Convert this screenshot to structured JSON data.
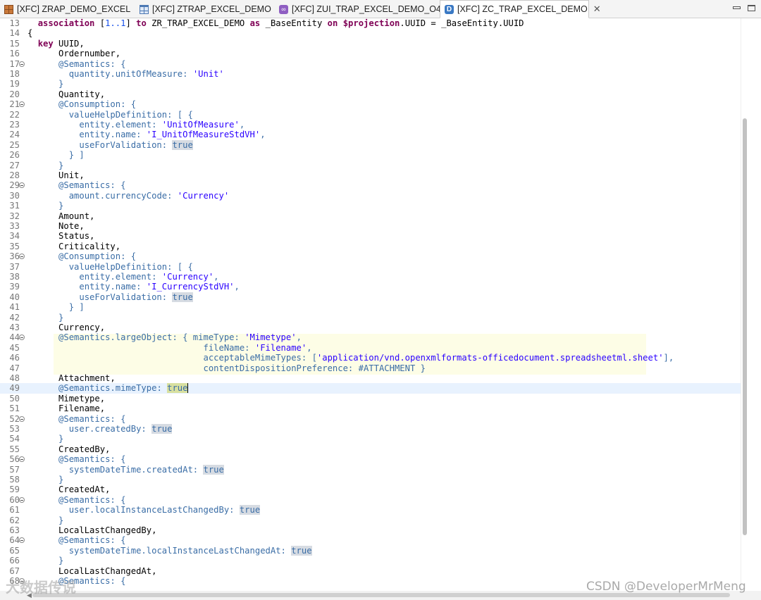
{
  "tabs": [
    {
      "label": "[XFC] ZRAP_DEMO_EXCEL",
      "icon": "database-table-icon",
      "active": false
    },
    {
      "label": "[XFC] ZTRAP_EXCEL_DEMO",
      "icon": "table-icon",
      "active": false
    },
    {
      "label": "[XFC] ZUI_TRAP_EXCEL_DEMO_O4",
      "icon": "service-binding-icon",
      "active": false
    },
    {
      "label": "[XFC] ZC_TRAP_EXCEL_DEMO",
      "icon": "data-definition-icon",
      "active": true,
      "icon_letter": "D"
    }
  ],
  "code_lines": [
    {
      "n": "13",
      "s": [
        [
          "  ",
          ""
        ],
        [
          "association",
          "kw"
        ],
        [
          " [",
          ""
        ],
        [
          "1..1",
          "num"
        ],
        [
          "] ",
          ""
        ],
        [
          "to",
          "kw"
        ],
        [
          " ZR_TRAP_EXCEL_DEMO ",
          ""
        ],
        [
          "as",
          "kw"
        ],
        [
          " _BaseEntity ",
          ""
        ],
        [
          "on",
          "kw"
        ],
        [
          " ",
          ""
        ],
        [
          "$projection",
          "kw"
        ],
        [
          ".UUID = _BaseEntity.UUID",
          ""
        ]
      ]
    },
    {
      "n": "14",
      "s": [
        [
          "{",
          ""
        ]
      ]
    },
    {
      "n": "15",
      "s": [
        [
          "  ",
          ""
        ],
        [
          "key",
          "kw"
        ],
        [
          " UUID,",
          ""
        ]
      ]
    },
    {
      "n": "16",
      "s": [
        [
          "      Ordernumber,",
          ""
        ]
      ]
    },
    {
      "n": "17",
      "fold": true,
      "s": [
        [
          "      ",
          ""
        ],
        [
          "@Semantics: {",
          "ann"
        ]
      ]
    },
    {
      "n": "18",
      "s": [
        [
          "        ",
          ""
        ],
        [
          "quantity.unitOfMeasure: ",
          "ann"
        ],
        [
          "'Unit'",
          "str"
        ]
      ]
    },
    {
      "n": "19",
      "s": [
        [
          "      ",
          ""
        ],
        [
          "}",
          "ann"
        ]
      ]
    },
    {
      "n": "20",
      "s": [
        [
          "      Quantity,",
          ""
        ]
      ]
    },
    {
      "n": "21",
      "fold": true,
      "s": [
        [
          "      ",
          ""
        ],
        [
          "@Consumption: {",
          "ann"
        ]
      ]
    },
    {
      "n": "22",
      "s": [
        [
          "        ",
          ""
        ],
        [
          "valueHelpDefinition: [ {",
          "ann"
        ]
      ]
    },
    {
      "n": "23",
      "s": [
        [
          "          ",
          ""
        ],
        [
          "entity.element: ",
          "ann"
        ],
        [
          "'UnitOfMeasure'",
          "str"
        ],
        [
          ",",
          "ann"
        ]
      ]
    },
    {
      "n": "24",
      "s": [
        [
          "          ",
          ""
        ],
        [
          "entity.name: ",
          "ann"
        ],
        [
          "'I_UnitOfMeasureStdVH'",
          "str"
        ],
        [
          ",",
          "ann"
        ]
      ]
    },
    {
      "n": "25",
      "s": [
        [
          "          ",
          ""
        ],
        [
          "useForValidation: ",
          "ann"
        ],
        [
          "true",
          "lit"
        ]
      ]
    },
    {
      "n": "26",
      "s": [
        [
          "        ",
          ""
        ],
        [
          "} ]",
          "ann"
        ]
      ]
    },
    {
      "n": "27",
      "s": [
        [
          "      ",
          ""
        ],
        [
          "}",
          "ann"
        ]
      ]
    },
    {
      "n": "28",
      "s": [
        [
          "      Unit,",
          ""
        ]
      ]
    },
    {
      "n": "29",
      "fold": true,
      "s": [
        [
          "      ",
          ""
        ],
        [
          "@Semantics: {",
          "ann"
        ]
      ]
    },
    {
      "n": "30",
      "s": [
        [
          "        ",
          ""
        ],
        [
          "amount.currencyCode: ",
          "ann"
        ],
        [
          "'Currency'",
          "str"
        ]
      ]
    },
    {
      "n": "31",
      "s": [
        [
          "      ",
          ""
        ],
        [
          "}",
          "ann"
        ]
      ]
    },
    {
      "n": "32",
      "s": [
        [
          "      Amount,",
          ""
        ]
      ]
    },
    {
      "n": "33",
      "s": [
        [
          "      Note,",
          ""
        ]
      ]
    },
    {
      "n": "34",
      "s": [
        [
          "      Status,",
          ""
        ]
      ]
    },
    {
      "n": "35",
      "s": [
        [
          "      Criticality,",
          ""
        ]
      ]
    },
    {
      "n": "36",
      "fold": true,
      "s": [
        [
          "      ",
          ""
        ],
        [
          "@Consumption: {",
          "ann"
        ]
      ]
    },
    {
      "n": "37",
      "s": [
        [
          "        ",
          ""
        ],
        [
          "valueHelpDefinition: [ {",
          "ann"
        ]
      ]
    },
    {
      "n": "38",
      "s": [
        [
          "          ",
          ""
        ],
        [
          "entity.element: ",
          "ann"
        ],
        [
          "'Currency'",
          "str"
        ],
        [
          ",",
          "ann"
        ]
      ]
    },
    {
      "n": "39",
      "s": [
        [
          "          ",
          ""
        ],
        [
          "entity.name: ",
          "ann"
        ],
        [
          "'I_CurrencyStdVH'",
          "str"
        ],
        [
          ",",
          "ann"
        ]
      ]
    },
    {
      "n": "40",
      "s": [
        [
          "          ",
          ""
        ],
        [
          "useForValidation: ",
          "ann"
        ],
        [
          "true",
          "lit"
        ]
      ]
    },
    {
      "n": "41",
      "s": [
        [
          "        ",
          ""
        ],
        [
          "} ]",
          "ann"
        ]
      ]
    },
    {
      "n": "42",
      "s": [
        [
          "      ",
          ""
        ],
        [
          "}",
          "ann"
        ]
      ]
    },
    {
      "n": "43",
      "s": [
        [
          "      Currency,",
          ""
        ]
      ]
    },
    {
      "n": "44",
      "fold": true,
      "s": [
        [
          "      ",
          ""
        ],
        [
          "@Semantics.largeObject: { mimeType: ",
          "ann"
        ],
        [
          "'Mimetype'",
          "str"
        ],
        [
          ",",
          "ann"
        ]
      ]
    },
    {
      "n": "45",
      "s": [
        [
          "                                  ",
          ""
        ],
        [
          "fileName: ",
          "ann"
        ],
        [
          "'Filename'",
          "str"
        ],
        [
          ",",
          "ann"
        ]
      ]
    },
    {
      "n": "46",
      "s": [
        [
          "                                  ",
          ""
        ],
        [
          "acceptableMimeTypes: [",
          "ann"
        ],
        [
          "'application/vnd.openxmlformats-officedocument.spreadsheetml.sheet'",
          "str"
        ],
        [
          "],",
          "ann"
        ]
      ]
    },
    {
      "n": "47",
      "s": [
        [
          "                                  ",
          ""
        ],
        [
          "contentDispositionPreference: #ATTACHMENT }",
          "ann"
        ]
      ]
    },
    {
      "n": "48",
      "s": [
        [
          "      Attachment,",
          ""
        ]
      ]
    },
    {
      "n": "49",
      "cur": true,
      "s": [
        [
          "      ",
          ""
        ],
        [
          "@Semantics.mimeType: ",
          "ann"
        ],
        [
          "true",
          "lit sel"
        ],
        [
          "",
          "cursor"
        ]
      ]
    },
    {
      "n": "50",
      "s": [
        [
          "      Mimetype,",
          ""
        ]
      ]
    },
    {
      "n": "51",
      "s": [
        [
          "      Filename,",
          ""
        ]
      ]
    },
    {
      "n": "52",
      "fold": true,
      "s": [
        [
          "      ",
          ""
        ],
        [
          "@Semantics: {",
          "ann"
        ]
      ]
    },
    {
      "n": "53",
      "s": [
        [
          "        ",
          ""
        ],
        [
          "user.createdBy: ",
          "ann"
        ],
        [
          "true",
          "lit"
        ]
      ]
    },
    {
      "n": "54",
      "s": [
        [
          "      ",
          ""
        ],
        [
          "}",
          "ann"
        ]
      ]
    },
    {
      "n": "55",
      "s": [
        [
          "      CreatedBy,",
          ""
        ]
      ]
    },
    {
      "n": "56",
      "fold": true,
      "s": [
        [
          "      ",
          ""
        ],
        [
          "@Semantics: {",
          "ann"
        ]
      ]
    },
    {
      "n": "57",
      "s": [
        [
          "        ",
          ""
        ],
        [
          "systemDateTime.createdAt: ",
          "ann"
        ],
        [
          "true",
          "lit"
        ]
      ]
    },
    {
      "n": "58",
      "s": [
        [
          "      ",
          ""
        ],
        [
          "}",
          "ann"
        ]
      ]
    },
    {
      "n": "59",
      "s": [
        [
          "      CreatedAt,",
          ""
        ]
      ]
    },
    {
      "n": "60",
      "fold": true,
      "s": [
        [
          "      ",
          ""
        ],
        [
          "@Semantics: {",
          "ann"
        ]
      ]
    },
    {
      "n": "61",
      "s": [
        [
          "        ",
          ""
        ],
        [
          "user.localInstanceLastChangedBy: ",
          "ann"
        ],
        [
          "true",
          "lit"
        ]
      ]
    },
    {
      "n": "62",
      "s": [
        [
          "      ",
          ""
        ],
        [
          "}",
          "ann"
        ]
      ]
    },
    {
      "n": "63",
      "s": [
        [
          "      LocalLastChangedBy,",
          ""
        ]
      ]
    },
    {
      "n": "64",
      "fold": true,
      "s": [
        [
          "      ",
          ""
        ],
        [
          "@Semantics: {",
          "ann"
        ]
      ]
    },
    {
      "n": "65",
      "s": [
        [
          "        ",
          ""
        ],
        [
          "systemDateTime.localInstanceLastChangedAt: ",
          "ann"
        ],
        [
          "true",
          "lit"
        ]
      ]
    },
    {
      "n": "66",
      "s": [
        [
          "      ",
          ""
        ],
        [
          "}",
          "ann"
        ]
      ]
    },
    {
      "n": "67",
      "s": [
        [
          "      LocalLastChangedAt,",
          ""
        ]
      ]
    },
    {
      "n": "68",
      "fold": true,
      "s": [
        [
          "      ",
          ""
        ],
        [
          "@Semantics: {",
          "ann"
        ]
      ]
    }
  ],
  "watermark_left": "大数据传说",
  "watermark_right": "CSDN @DeveloperMrMeng",
  "colors": {
    "keyword": "#7f0055",
    "annotation": "#3a6da6",
    "string": "#2a00ff",
    "current_line": "#e8f2fe"
  }
}
